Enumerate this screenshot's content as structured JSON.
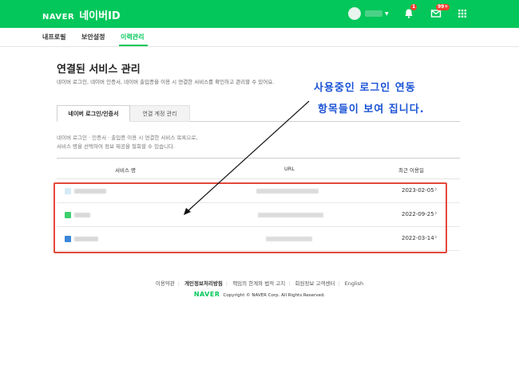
{
  "header": {
    "logo": "NAVER",
    "title": "네이버ID",
    "notification_count": "1",
    "mail_count": "99+"
  },
  "subnav": {
    "tabs": [
      "내프로필",
      "보안설정",
      "이력관리"
    ],
    "active": "이력관리"
  },
  "main": {
    "title": "연결된 서비스 관리",
    "description": "네이버 로그인, 네이버 인증서, 네이버 출입증을 이용 시 연결한 서비스를 확인하고 관리할 수 있어요.",
    "tabs": [
      "네이버 로그인/인증서",
      "연결 계정 관리"
    ],
    "info_lines": [
      "네이버 로그인 · 인증서 · 출입증 이용 시 연결한 서비스 목록으로,",
      "서비스 명을 선택하여 정보 제공을 철회할 수 있습니다."
    ],
    "table": {
      "columns": [
        "서비스 명",
        "URL",
        "최근 이용일"
      ],
      "rows": [
        {
          "date": "2023-02-05",
          "icon_color": "#cfe8f7"
        },
        {
          "date": "2022-09-25",
          "icon_color": "#3ecf6e"
        },
        {
          "date": "2022-03-14",
          "icon_color": "#3a86d8"
        }
      ]
    }
  },
  "annotation": {
    "line1": "사용중인 로그인 연동",
    "line2": "항목들이 보여 집니다."
  },
  "footer": {
    "links": [
      "이용약관",
      "개인정보처리방침",
      "책임의 한계와 법적 고지",
      "회원정보 고객센터",
      "English"
    ],
    "logo": "NAVER",
    "copyright": "Copyright © NAVER Corp. All Rights Reserved."
  },
  "colors": {
    "brand_green": "#03c75a",
    "highlight_red": "#e3473a",
    "annotation_blue": "#1a53d6"
  }
}
